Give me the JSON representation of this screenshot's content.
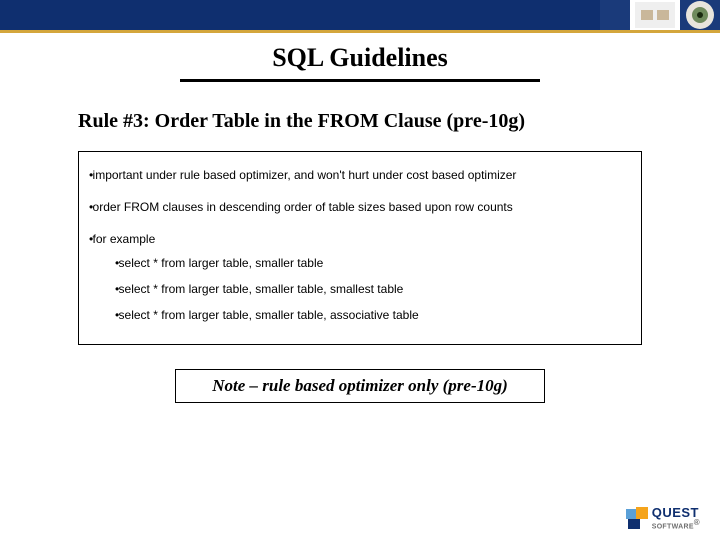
{
  "header": {
    "title": "SQL Guidelines"
  },
  "rule": {
    "heading": "Rule #3: Order Table in the FROM Clause (pre-10g)"
  },
  "bullets": {
    "b1": "important under rule based optimizer, and won't hurt under cost based optimizer",
    "b2": "order FROM clauses in descending order of table sizes based upon row counts",
    "b3": "for example",
    "sub1": "select * from larger table, smaller table",
    "sub2": "select * from larger table, smaller table, smallest table",
    "sub3": "select * from larger table, smaller table, associative table"
  },
  "note": {
    "text": "Note – rule based optimizer only (pre-10g)"
  },
  "footer": {
    "brand1": "QUEST",
    "brand2": "SOFTWARE",
    "reg": "®"
  }
}
